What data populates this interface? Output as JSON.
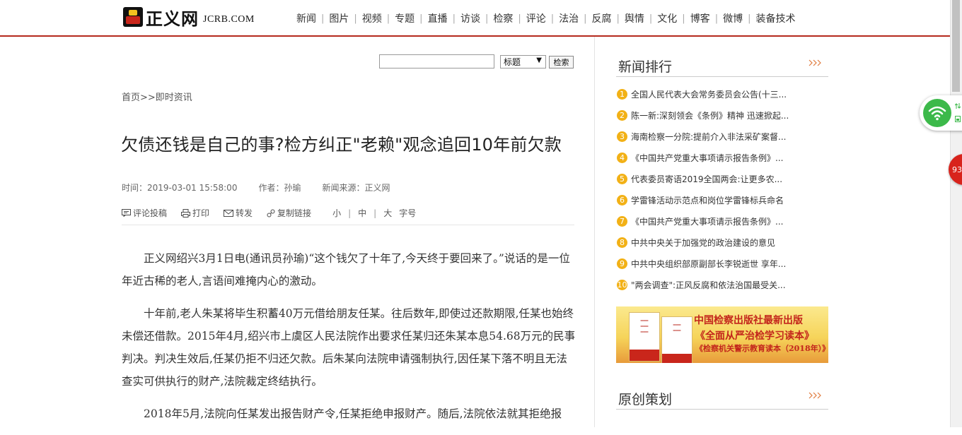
{
  "header": {
    "logo_text": "正义网",
    "logo_domain": "JCRB.COM",
    "nav": [
      "新闻",
      "图片",
      "视频",
      "专题",
      "直播",
      "访谈",
      "检察",
      "评论",
      "法治",
      "反腐",
      "舆情",
      "文化",
      "博客",
      "微博",
      "装备技术"
    ]
  },
  "search": {
    "input_value": "",
    "select_value": "标题",
    "button_label": "检索"
  },
  "breadcrumb": "首页>>即时资讯",
  "article": {
    "title": "欠债还钱是自己的事?检方纠正\"老赖\"观念追回10年前欠款",
    "time": "时间：2019-03-01 15:58:00",
    "author": "作者：孙瑜",
    "source": "新闻来源：正义网",
    "tools": {
      "comment": "评论投稿",
      "print": "打印",
      "forward": "转发",
      "copy_link": "复制链接",
      "font_small": "小",
      "font_medium": "中",
      "font_large": "大",
      "font_label": "字号"
    },
    "paragraphs": [
      "正义网绍兴3月1日电(通讯员孙瑜)“这个钱欠了十年了,今天终于要回来了。”说话的是一位年近古稀的老人,言语间难掩内心的激动。",
      "十年前,老人朱某将毕生积蓄40万元借给朋友任某。往后数年,即使过还款期限,任某也始终未偿还借款。2015年4月,绍兴市上虞区人民法院作出要求任某归还朱某本息54.68万元的民事判决。判决生效后,任某仍拒不归还欠款。后朱某向法院申请强制执行,因任某下落不明且无法查实可供执行的财产,法院裁定终结执行。",
      "2018年5月,法院向任某发出报告财产令,任某拒绝申报财产。随后,法院依法就其拒绝报"
    ]
  },
  "sidebar": {
    "ranking_title": "新闻排行",
    "ranking": [
      "全国人民代表大会常务委员会公告(十三...",
      "陈一新:深刻领会《条例》精神 迅速掀起...",
      "海南检察一分院:提前介入非法采矿案督...",
      "《中国共产党重大事项请示报告条例》...",
      "代表委员寄语2019全国两会:让更多农...",
      "学雷锋活动示范点和岗位学雷锋标兵命名",
      "《中国共产党重大事项请示报告条例》...",
      "中共中央关于加强党的政治建设的意见",
      "中共中央组织部原副部长李锐逝世 享年...",
      "\"两会调查\":正风反腐和依法治国最受关..."
    ],
    "banner": {
      "line1": "中国检察出版社最新出版",
      "line2": "《全面从严治检学习读本》",
      "line3": "《检察机关警示教育读本（2018年）》"
    },
    "original_title": "原创策划"
  },
  "widgets": {
    "badge_count": "93"
  },
  "colors": {
    "brand_red": "#b5291d",
    "rank_badge": "#f2b116",
    "wifi_green": "#3cb94a"
  }
}
